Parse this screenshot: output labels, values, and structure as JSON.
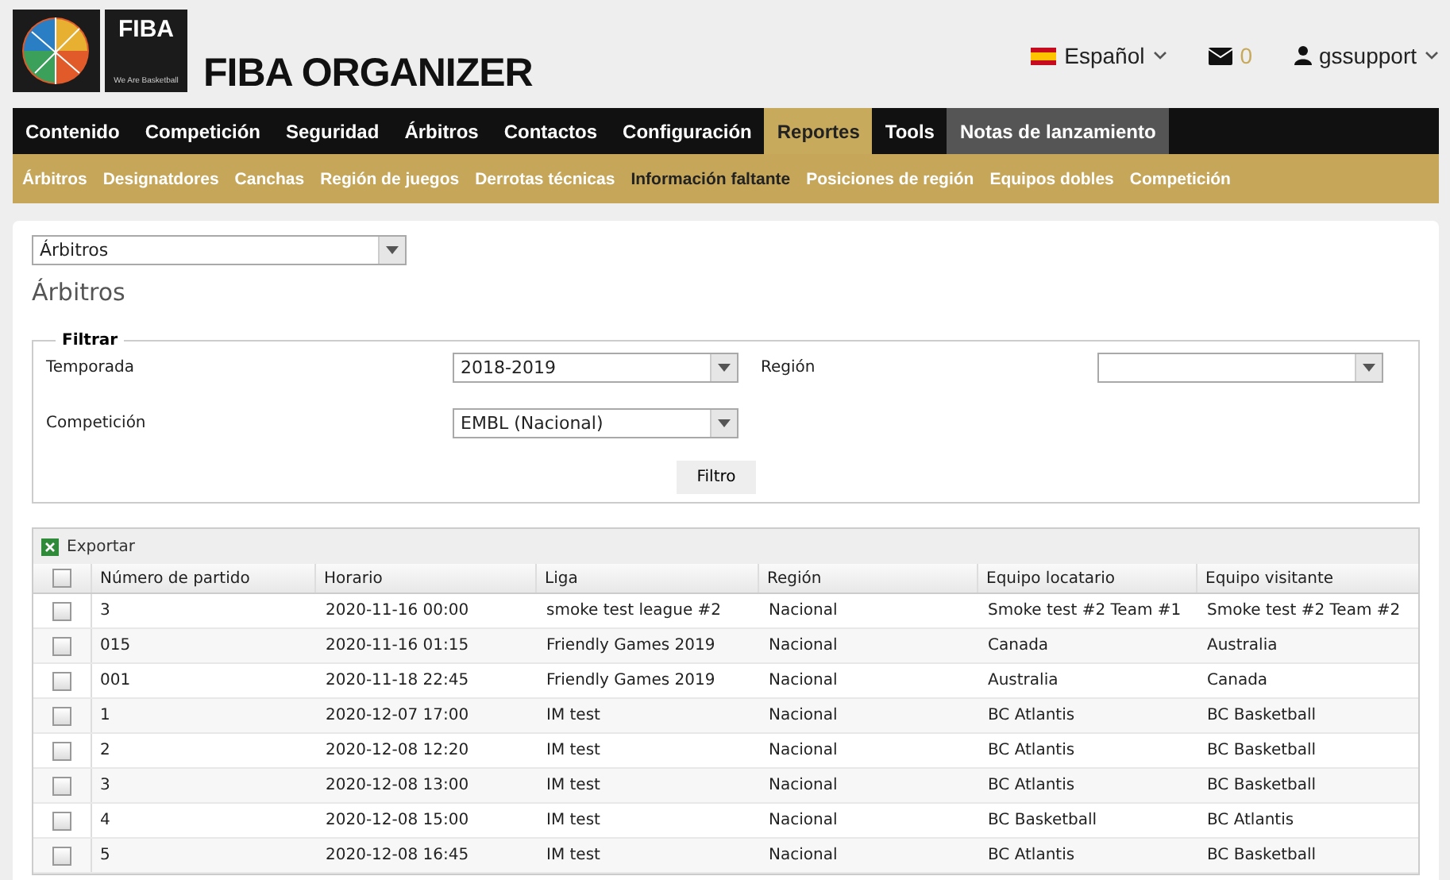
{
  "header": {
    "logo_text": "FIBA",
    "logo_tagline": "We Are Basketball",
    "title": "FIBA ORGANIZER",
    "language": "Español",
    "messages": "0",
    "user": "gssupport"
  },
  "nav": [
    {
      "label": "Contenido",
      "selected": false,
      "hovered": false
    },
    {
      "label": "Competición",
      "selected": false,
      "hovered": false
    },
    {
      "label": "Seguridad",
      "selected": false,
      "hovered": false
    },
    {
      "label": "Árbitros",
      "selected": false,
      "hovered": false
    },
    {
      "label": "Contactos",
      "selected": false,
      "hovered": false
    },
    {
      "label": "Configuración",
      "selected": false,
      "hovered": false
    },
    {
      "label": "Reportes",
      "selected": true,
      "hovered": false
    },
    {
      "label": "Tools",
      "selected": false,
      "hovered": false
    },
    {
      "label": "Notas de lanzamiento",
      "selected": false,
      "hovered": true
    }
  ],
  "subnav": [
    {
      "label": "Árbitros",
      "selected": false
    },
    {
      "label": "Designatdores",
      "selected": false
    },
    {
      "label": "Canchas",
      "selected": false
    },
    {
      "label": "Región de juegos",
      "selected": false
    },
    {
      "label": "Derrotas técnicas",
      "selected": false
    },
    {
      "label": "Información faltante",
      "selected": true
    },
    {
      "label": "Posiciones de región",
      "selected": false
    },
    {
      "label": "Equipos dobles",
      "selected": false
    },
    {
      "label": "Competición",
      "selected": false
    }
  ],
  "report_select": {
    "value": "Árbitros"
  },
  "heading": "Árbitros",
  "filter": {
    "legend": "Filtrar",
    "fields": [
      {
        "label": "Temporada",
        "value": "2018-2019"
      },
      {
        "label": "Región"
      },
      {
        "label": "Competición",
        "value": "EMBL (Nacional)"
      }
    ],
    "button": "Filtro"
  },
  "table": {
    "toolbar": "Exportar",
    "select_all_checked": false,
    "columns": [
      "Número de partido",
      "Horario",
      "Liga",
      "Región",
      "Equipo locatario",
      "Equipo visitante"
    ],
    "rows": [
      {
        "checked": false,
        "cells": [
          "3",
          "2020-11-16 00:00",
          "smoke test league #2",
          "Nacional",
          "Smoke test #2 Team #1",
          "Smoke test #2 Team #2"
        ]
      },
      {
        "checked": false,
        "cells": [
          "015",
          "2020-11-16 01:15",
          "Friendly Games 2019",
          "Nacional",
          "Canada",
          "Australia"
        ]
      },
      {
        "checked": false,
        "cells": [
          "001",
          "2020-11-18 22:45",
          "Friendly Games 2019",
          "Nacional",
          "Australia",
          "Canada"
        ]
      },
      {
        "checked": false,
        "cells": [
          "1",
          "2020-12-07 17:00",
          "IM test",
          "Nacional",
          "BC Atlantis",
          "BC Basketball"
        ]
      },
      {
        "checked": false,
        "cells": [
          "2",
          "2020-12-08 12:20",
          "IM test",
          "Nacional",
          "BC Atlantis",
          "BC Basketball"
        ]
      },
      {
        "checked": false,
        "cells": [
          "3",
          "2020-12-08 13:00",
          "IM test",
          "Nacional",
          "BC Atlantis",
          "BC Basketball"
        ]
      },
      {
        "checked": false,
        "cells": [
          "4",
          "2020-12-08 15:00",
          "IM test",
          "Nacional",
          "BC Basketball",
          "BC Atlantis"
        ]
      },
      {
        "checked": false,
        "cells": [
          "5",
          "2020-12-08 16:45",
          "IM test",
          "Nacional",
          "BC Atlantis",
          "BC Basketball"
        ]
      }
    ]
  }
}
